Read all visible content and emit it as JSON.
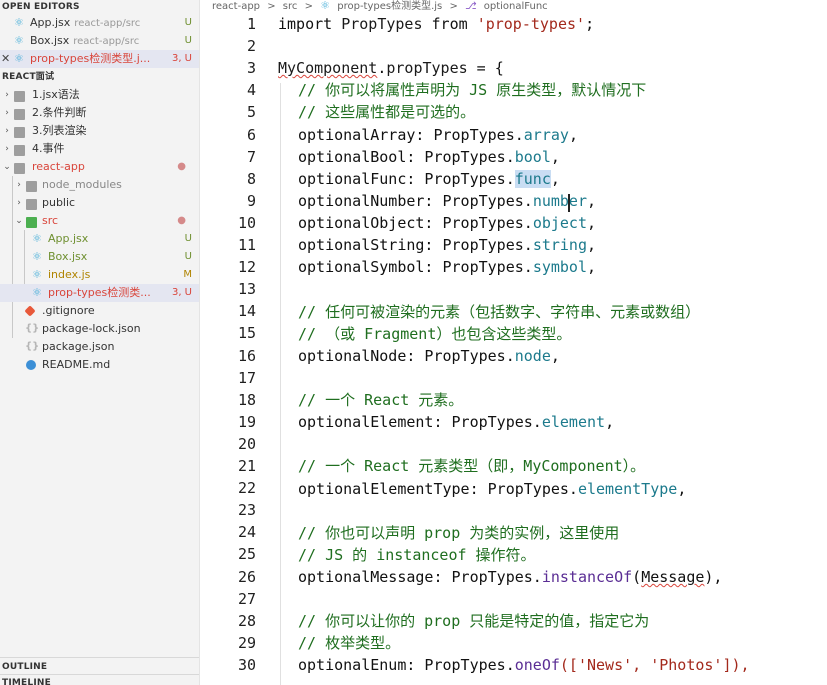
{
  "sidebar": {
    "open_editors_title": "OPEN EDITORS",
    "open_editors": [
      {
        "name": "App.jsx",
        "dir": "react-app/src",
        "badge": "U"
      },
      {
        "name": "Box.jsx",
        "dir": "react-app/src",
        "badge": "U"
      },
      {
        "name": "prop-types检测类型.j...",
        "dir": "",
        "badge": "3, U"
      }
    ],
    "workspace_title": "REACT面试",
    "tree": [
      {
        "name": "1.jsx语法",
        "badge": ""
      },
      {
        "name": "2.条件判断",
        "badge": ""
      },
      {
        "name": "3.列表渲染",
        "badge": ""
      },
      {
        "name": "4.事件",
        "badge": ""
      },
      {
        "name": "react-app",
        "badge": "●"
      },
      {
        "name": "node_modules",
        "badge": ""
      },
      {
        "name": "public",
        "badge": ""
      },
      {
        "name": "src",
        "badge": "●"
      },
      {
        "name": "App.jsx",
        "badge": "U"
      },
      {
        "name": "Box.jsx",
        "badge": "U"
      },
      {
        "name": "index.js",
        "badge": "M"
      },
      {
        "name": "prop-types检测类...",
        "badge": "3, U"
      },
      {
        "name": ".gitignore",
        "badge": ""
      },
      {
        "name": "package-lock.json",
        "badge": ""
      },
      {
        "name": "package.json",
        "badge": ""
      },
      {
        "name": "README.md",
        "badge": ""
      }
    ],
    "outline_title": "OUTLINE",
    "timeline_title": "TIMELINE"
  },
  "breadcrumbs": [
    "react-app",
    ">",
    "src",
    ">",
    "prop-types检测类型.js",
    ">",
    "optionalFunc"
  ],
  "code": {
    "line_numbers": [
      "1",
      "2",
      "3",
      "4",
      "5",
      "6",
      "7",
      "8",
      "9",
      "10",
      "11",
      "12",
      "13",
      "14",
      "15",
      "16",
      "17",
      "18",
      "19",
      "20",
      "21",
      "22",
      "23",
      "24",
      "25",
      "26",
      "27",
      "28",
      "29",
      "30"
    ],
    "tokens": {
      "l1_import": "import ",
      "l1_name": "PropTypes",
      "l1_from": " from ",
      "l1_str": "'prop-types'",
      "l1_end": ";",
      "l3_obj": "MyComponent",
      "l3_dot": ".",
      "l3_prop": "propTypes",
      "l3_end": " = {",
      "l4": "// 你可以将属性声明为 JS 原生类型，默认情况下",
      "l5": "// 这些属性都是可选的。",
      "l6_key": "optionalArray: PropTypes.",
      "l6_val": "array",
      "l7_key": "optionalBool: PropTypes.",
      "l7_val": "bool",
      "l8_key": "optionalFunc: PropTypes.",
      "l8_val": "func",
      "l9_key": "optionalNumber: PropTypes.",
      "l9_val": "number",
      "l10_key": "optionalObject: PropTypes.",
      "l10_val": "object",
      "l11_key": "optionalString: PropTypes.",
      "l11_val": "string",
      "l12_key": "optionalSymbol: PropTypes.",
      "l12_val": "symbol",
      "comma": ",",
      "l14": "// 任何可被渲染的元素（包括数字、字符串、元素或数组）",
      "l15": "// （或 Fragment）也包含这些类型。",
      "l16_key": "optionalNode: PropTypes.",
      "l16_val": "node",
      "l18": "// 一个 React 元素。",
      "l19_key": "optionalElement: PropTypes.",
      "l19_val": "element",
      "l21": "// 一个 React 元素类型（即，MyComponent）。",
      "l22_key": "optionalElementType: PropTypes.",
      "l22_val": "elementType",
      "l24": "// 你也可以声明 prop 为类的实例，这里使用",
      "l25": "// JS 的 instanceof 操作符。",
      "l26_key": "optionalMessage: PropTypes.",
      "l26_fn": "instanceOf",
      "l26_open": "(",
      "l26_arg": "Message",
      "l26_close": "),",
      "l28": "// 你可以让你的 prop 只能是特定的值，指定它为",
      "l29": "// 枚举类型。",
      "l30_key": "optionalEnum: PropTypes.",
      "l30_fn": "oneOf",
      "l30_args": "(['News', 'Photos']),"
    }
  }
}
